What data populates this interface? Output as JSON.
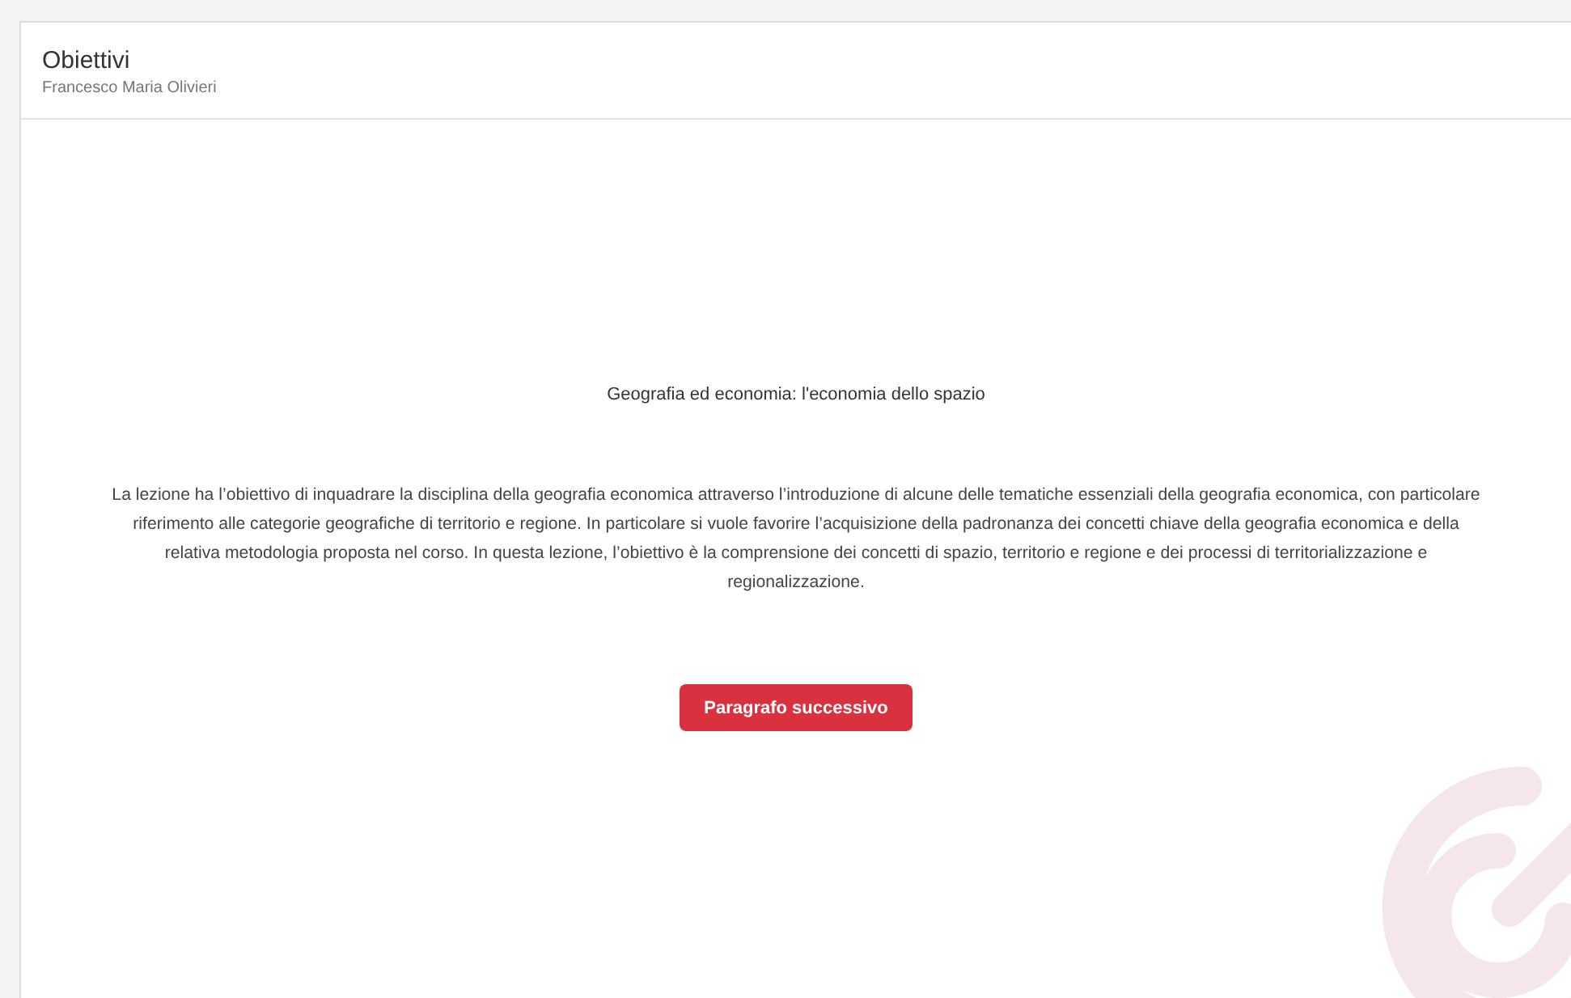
{
  "header": {
    "title": "Obiettivi",
    "subtitle": "Francesco Maria Olivieri"
  },
  "content": {
    "heading": "Geografia ed economia: l'economia dello spazio",
    "paragraph": "La lezione ha l’obiettivo di inquadrare la disciplina della geografia economica attraverso l’introduzione di alcune delle tematiche essenziali della geografia economica, con particolare riferimento alle categorie geografiche di territorio e regione. In particolare si vuole favorire l’acquisizione della padronanza dei concetti chiave della geografia economica e della relativa metodologia proposta nel corso. In questa lezione, l’obiettivo è la comprensione dei concetti di spazio, territorio e regione e dei processi di territorializzazione e regionalizzazione.",
    "button": "Paragrafo successivo"
  }
}
